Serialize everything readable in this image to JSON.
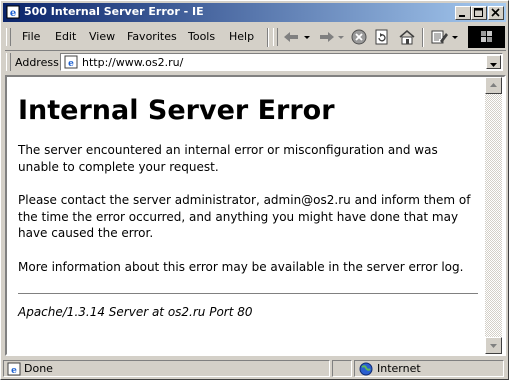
{
  "window": {
    "title": "500 Internal Server Error - IE",
    "controls": [
      "minimize",
      "maximize",
      "close"
    ]
  },
  "menubar": {
    "items": [
      "File",
      "Edit",
      "View",
      "Favorites",
      "Tools",
      "Help"
    ]
  },
  "toolbar": {
    "icons": [
      "back-arrow-icon",
      "forward-arrow-icon",
      "stop-icon",
      "refresh-icon",
      "home-icon",
      "edit-icon"
    ]
  },
  "addressbar": {
    "label": "Address",
    "url": "http://www.os2.ru/"
  },
  "page": {
    "heading": "Internal Server Error",
    "paragraph1": "The server encountered an internal error or misconfiguration and was unable to complete your request.",
    "paragraph2": "Please contact the server administrator, admin@os2.ru and inform them of the time the error occurred, and anything you might have done that may have caused the error.",
    "paragraph3": "More information about this error may be available in the server error log.",
    "signature": "Apache/1.3.14 Server at os2.ru Port 80"
  },
  "statusbar": {
    "status": "Done",
    "zone": "Internet"
  },
  "colors": {
    "titlebar_start": "#0a246a",
    "titlebar_end": "#a6caf0",
    "chrome": "#d4d0c8"
  }
}
